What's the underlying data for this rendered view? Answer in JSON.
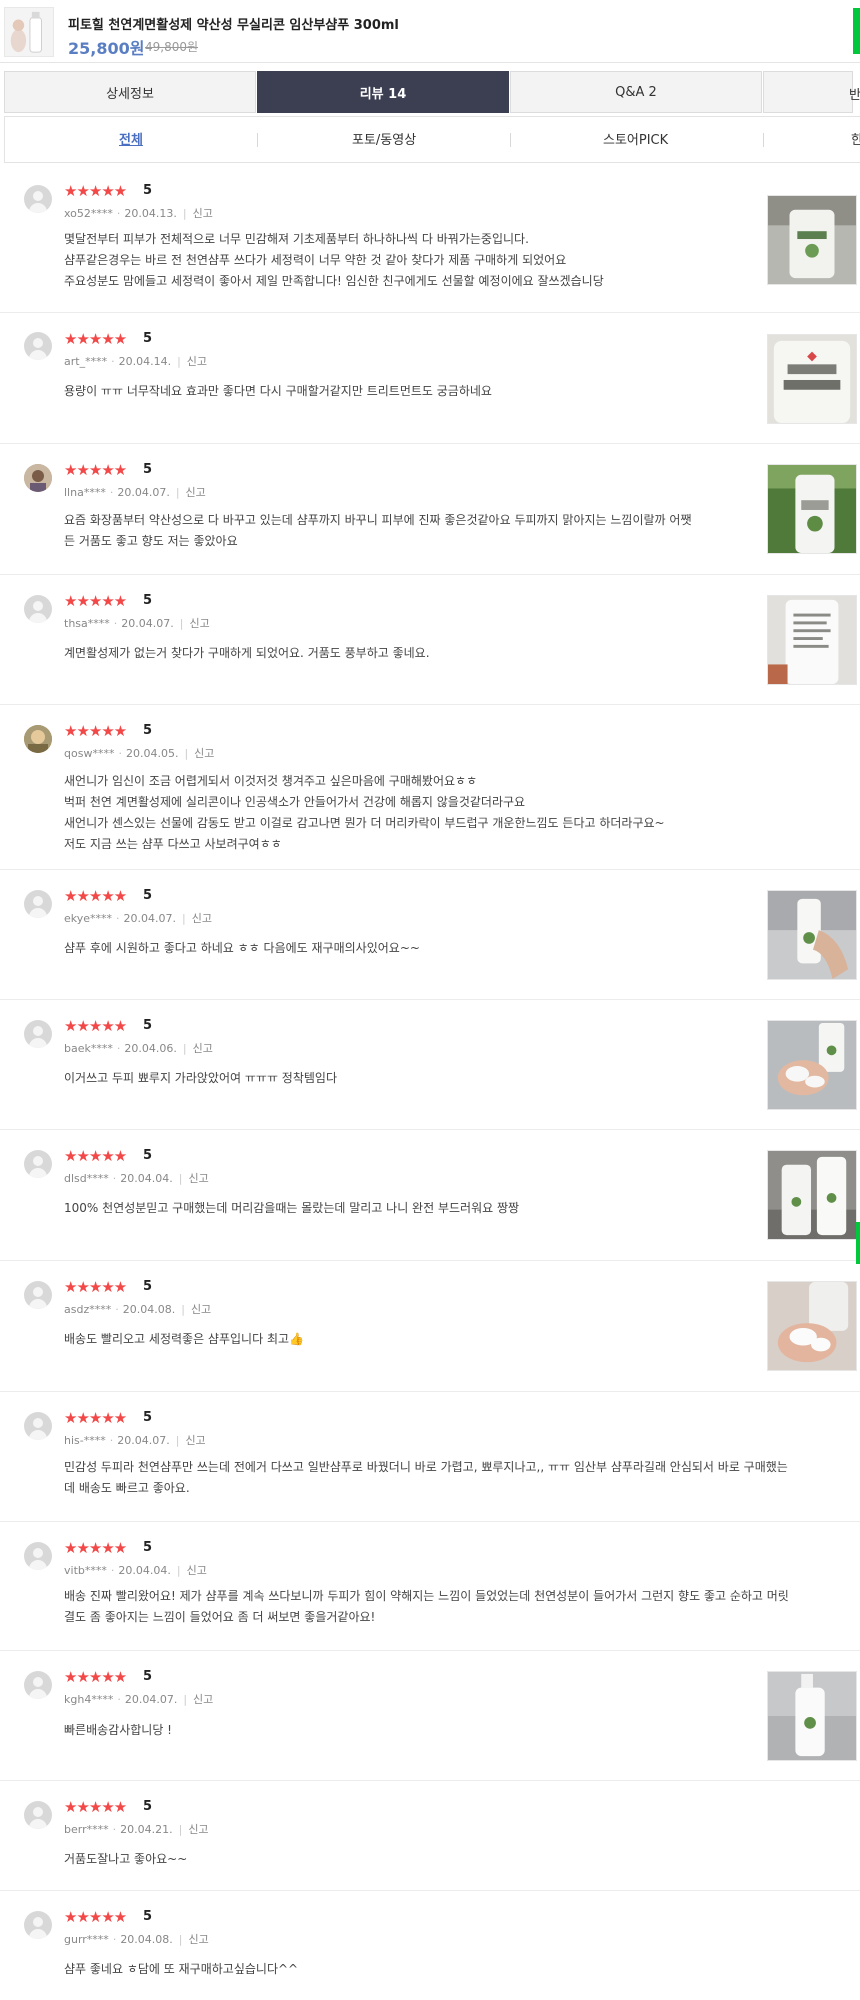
{
  "product": {
    "title": "피토힐 천연계면활성제 약산성 무실리콘 임산부샴푸 300ml",
    "price": "25,800원",
    "original_price": "49,800원"
  },
  "tabs": [
    {
      "label": "상세정보"
    },
    {
      "label": "리뷰 14"
    },
    {
      "label": "Q&A 2"
    },
    {
      "label": "반"
    }
  ],
  "subtabs": [
    {
      "label": "전체"
    },
    {
      "label": "포토/동영상"
    },
    {
      "label": "스토어PICK"
    },
    {
      "label": "한"
    }
  ],
  "review_common": {
    "stars": "★★★★★",
    "report_label": "신고"
  },
  "reviews": [
    {
      "score": "5",
      "user": "xo52****",
      "date": "20.04.13.",
      "text": [
        "몇달전부터 피부가 전체적으로 너무 민감해져 기초제품부터 하나하나씩 다 바꿔가는중입니다.",
        "샴푸같은경우는 바르 전 천연샴푸 쓰다가 세정력이 너무 약한 것 같아 찾다가 제품 구매하게 되었어요",
        "주요성분도 맘에들고 세정력이 좋아서 제일 만족합니다! 임신한 친구에게도 선물할 예정이에요 잘쓰겠습니당"
      ]
    },
    {
      "score": "5",
      "user": "art_****",
      "date": "20.04.14.",
      "text": [
        "용량이 ㅠㅠ 너무작네요 효과만 좋다면 다시 구매할거같지만 트리트먼트도 궁금하네요"
      ]
    },
    {
      "score": "5",
      "user": "llna****",
      "date": "20.04.07.",
      "text": [
        "요즘 화장품부터 약산성으로 다 바꾸고 있는데 샴푸까지 바꾸니 피부에 진짜 좋은것같아요 두피까지 맑아지는 느낌이랄까 어쨋",
        "든 거품도 좋고 향도 저는 좋았아요"
      ]
    },
    {
      "score": "5",
      "user": "thsa****",
      "date": "20.04.07.",
      "text": [
        "계면활성제가 없는거 찾다가 구매하게 되었어요. 거품도 풍부하고 좋네요."
      ]
    },
    {
      "score": "5",
      "user": "qosw****",
      "date": "20.04.05.",
      "text": [
        "새언니가 임신이 조금 어렵게되서 이것저것 챙겨주고 싶은마음에 구매해봤어요ㅎㅎ",
        "벅퍼 천연 계면활성제에 실리콘이나 인공색소가 안들어가서 건강에 해롭지 않을것같더라구요",
        "새언니가 센스있는 선물에 감동도 받고 이걸로 감고나면 뭔가 더 머리카락이 부드럽구 개운한느낌도 든다고 하더라구요~",
        "저도 지금 쓰는 샴푸 다쓰고 사보려구여ㅎㅎ"
      ]
    },
    {
      "score": "5",
      "user": "ekye****",
      "date": "20.04.07.",
      "text": [
        "샴푸 후에 시원하고 좋다고 하네요 ㅎㅎ 다음에도 재구매의사있어요~~"
      ]
    },
    {
      "score": "5",
      "user": "baek****",
      "date": "20.04.06.",
      "text": [
        "이거쓰고 두피 뾰루지 가라앉았어여 ㅠㅠㅠ 정착템임다"
      ]
    },
    {
      "score": "5",
      "user": "dlsd****",
      "date": "20.04.04.",
      "text": [
        "100% 천연성분믿고 구매했는데 머리감을때는 몰랐는데 말리고 나니 완전 부드러워요 짱짱"
      ]
    },
    {
      "score": "5",
      "user": "asdz****",
      "date": "20.04.08.",
      "text": [
        "배송도 빨리오고 세정력좋은 샴푸입니다 최고👍"
      ]
    },
    {
      "score": "5",
      "user": "his-****",
      "date": "20.04.07.",
      "text": [
        "민감성 두피라 천연샴푸만 쓰는데 전에거 다쓰고 일반샴푸로 바꿨더니 바로 가렵고, 뾰루지나고,, ㅠㅠ 임산부 샴푸라길래 안심되서 바로 구매했는",
        "데 배송도 빠르고 좋아요."
      ]
    },
    {
      "score": "5",
      "user": "vitb****",
      "date": "20.04.04.",
      "text": [
        "배송 진짜 빨리왔어요! 제가 샴푸를 계속 쓰다보니까 두피가 힘이 약해지는 느낌이 들었었는데 천연성분이 들어가서 그런지 향도 좋고 순하고 머릿",
        "결도 좀 좋아지는 느낌이 들었어요 좀 더 써보면 좋을거같아요!"
      ]
    },
    {
      "score": "5",
      "user": "kgh4****",
      "date": "20.04.07.",
      "text": [
        "빠른배송감사합니당 !"
      ]
    },
    {
      "score": "5",
      "user": "berr****",
      "date": "20.04.21.",
      "text": [
        "거품도잘나고  좋아요~~"
      ]
    },
    {
      "score": "5",
      "user": "gurr****",
      "date": "20.04.08.",
      "text": [
        "샴푸 좋네요 ㅎ담에 또 재구매하고싶습니다^^"
      ]
    }
  ]
}
